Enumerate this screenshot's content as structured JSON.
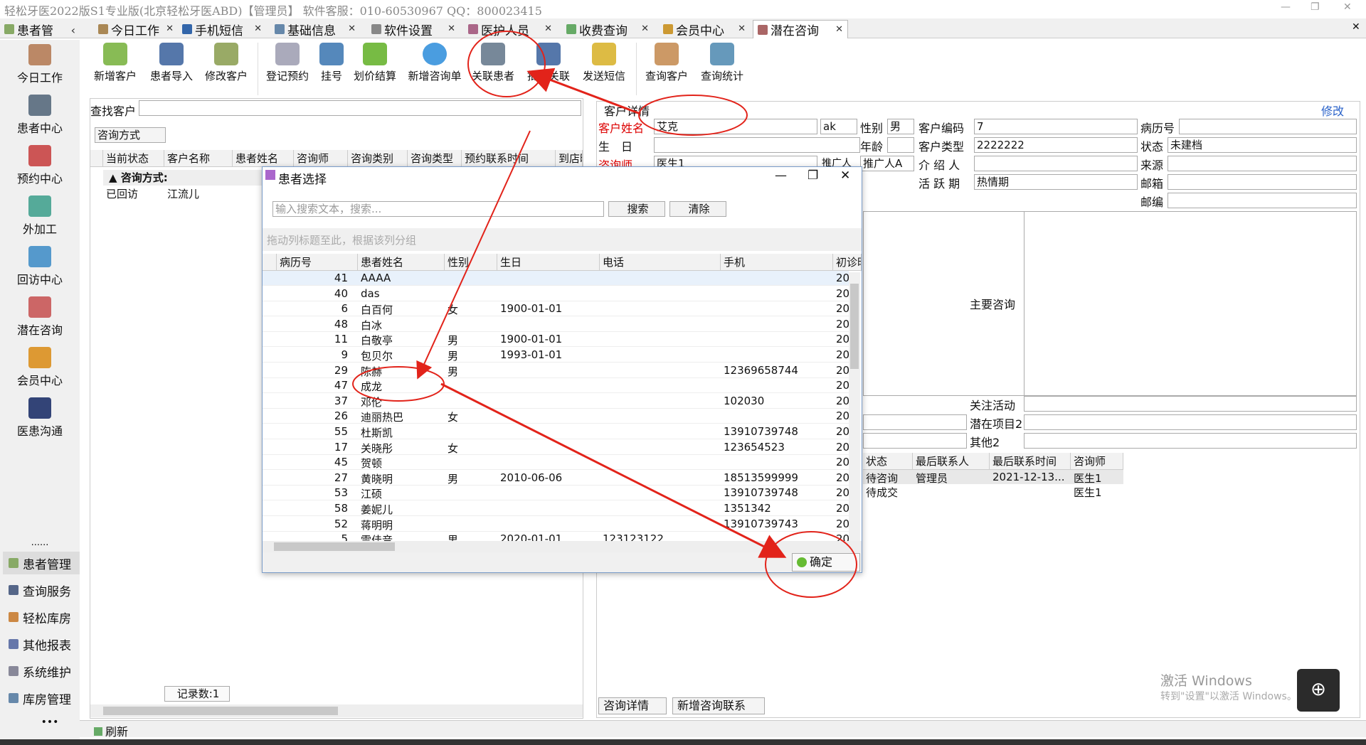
{
  "title": "轻松牙医2022版S1专业版(北京轻松牙医ABD)【管理员】   软件客服：010-60530967 QQ：800023415",
  "window_controls": [
    "—",
    "❐",
    "✕"
  ],
  "tabs": [
    {
      "label": "患者管"
    },
    {
      "label": "今日工作"
    },
    {
      "label": "手机短信"
    },
    {
      "label": "基础信息"
    },
    {
      "label": "软件设置"
    },
    {
      "label": "医护人员"
    },
    {
      "label": "收费查询"
    },
    {
      "label": "会员中心"
    },
    {
      "label": "潜在咨询"
    }
  ],
  "tab_close": "✕",
  "tab_back": "‹",
  "leftnav": [
    "今日工作",
    "患者中心",
    "预约中心",
    "外加工",
    "回访中心",
    "潜在咨询",
    "会员中心",
    "医患沟通"
  ],
  "leftnav_more": "......",
  "leftbottom": [
    "患者管理",
    "查询服务",
    "轻松库房",
    "其他报表",
    "系统维护",
    "库房管理"
  ],
  "leftbottom_more": "•••",
  "ribbon": [
    "新增客户",
    "患者导入",
    "修改客户",
    "登记预约",
    "挂号",
    "划价结算",
    "新增咨询单",
    "关联患者",
    "批量关联",
    "发送短信",
    "查询客户",
    "查询统计"
  ],
  "left": {
    "find_label": "查找客户",
    "group_select": "咨询方式",
    "headers": [
      "当前状态",
      "客户名称",
      "患者姓名",
      "咨询师",
      "咨询类别",
      "咨询类型",
      "预约联系时间",
      "到店时"
    ],
    "group_row": "咨询方式:",
    "row": [
      "已回访",
      "江流儿"
    ],
    "records": "记录数:1"
  },
  "right": {
    "section": "客户详情",
    "edit": "修改",
    "labels": {
      "name": "客户姓名",
      "gender": "性别",
      "code": "客户编码",
      "record": "病历号",
      "birth": "生　日",
      "age": "年龄",
      "type": "客户类型",
      "status": "状态",
      "consultant": "咨询师",
      "promoter": "推广人",
      "introducer": "介 绍 人",
      "source": "来源",
      "active": "活 跃 期",
      "email": "邮箱",
      "zip": "邮编",
      "main": "主要咨询",
      "focus": "关注活动",
      "potential2": "潜在项目2",
      "other2": "其他2"
    },
    "values": {
      "name": "艾克",
      "pinyin": "ak",
      "gender": "男",
      "code": "7",
      "type": "2222222",
      "status": "未建档",
      "consultant": "医生1",
      "promoter": "推广人A",
      "active": "热情期"
    },
    "headers": [
      "状态",
      "最后联系人",
      "最后联系时间",
      "咨询师"
    ],
    "rows": [
      [
        "待咨询",
        "管理员",
        "2021-12-13...",
        "医生1"
      ],
      [
        "待成交",
        "",
        "",
        "医生1"
      ]
    ],
    "tabs": [
      "咨询详情",
      "新增咨询联系"
    ]
  },
  "dialog": {
    "title": "患者选择",
    "search_placeholder": "输入搜索文本，搜索...",
    "search": "搜索",
    "clear": "清除",
    "group_hint": "拖动列标题至此，根据该列分组",
    "headers": [
      "病历号",
      "患者姓名",
      "性别",
      "生日",
      "电话",
      "手机",
      "初诊时"
    ],
    "rows": [
      [
        "41",
        "AAAA",
        "",
        "",
        "",
        "",
        "202"
      ],
      [
        "40",
        "das",
        "",
        "",
        "",
        "",
        "202"
      ],
      [
        "6",
        "白百何",
        "女",
        "1900-01-01",
        "",
        "",
        "202"
      ],
      [
        "48",
        "白冰",
        "",
        "",
        "",
        "",
        "202"
      ],
      [
        "11",
        "白敬亭",
        "男",
        "1900-01-01",
        "",
        "",
        "202"
      ],
      [
        "9",
        "包贝尔",
        "男",
        "1993-01-01",
        "",
        "",
        "202"
      ],
      [
        "29",
        "陈赫",
        "男",
        "",
        "",
        "12369658744",
        "202"
      ],
      [
        "47",
        "成龙",
        "",
        "",
        "",
        "",
        "202"
      ],
      [
        "37",
        "邓伦",
        "",
        "",
        "",
        "102030",
        "202"
      ],
      [
        "26",
        "迪丽热巴",
        "女",
        "",
        "",
        "",
        "202"
      ],
      [
        "55",
        "杜斯凯",
        "",
        "",
        "",
        "13910739748",
        "202"
      ],
      [
        "17",
        "关晓彤",
        "女",
        "",
        "",
        "123654523",
        "202"
      ],
      [
        "45",
        "贺顿",
        "",
        "",
        "",
        "",
        "202"
      ],
      [
        "27",
        "黄晓明",
        "男",
        "2010-06-06",
        "",
        "18513599999",
        "202"
      ],
      [
        "53",
        "江硕",
        "",
        "",
        "",
        "13910739748",
        "202"
      ],
      [
        "58",
        "姜妮儿",
        "",
        "",
        "",
        "1351342",
        "202"
      ],
      [
        "52",
        "蒋明明",
        "",
        "",
        "",
        "13910739743",
        "202"
      ],
      [
        "5",
        "雷佳音",
        "男",
        "2020-01-01",
        "123123122",
        "",
        "202"
      ]
    ],
    "ok": "确定"
  },
  "status": "刷新",
  "watermark1": "激活 Windows",
  "watermark2": "转到\"设置\"以激活 Windows。"
}
